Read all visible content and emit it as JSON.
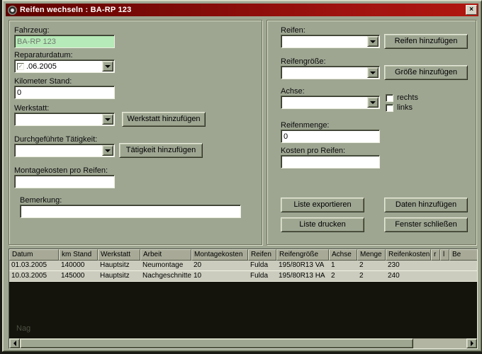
{
  "window": {
    "title": "Reifen wechseln : BA-RP 123",
    "close_glyph": "×"
  },
  "form_left": {
    "fahrzeug": {
      "label": "Fahrzeug:",
      "value": "BA-RP 123"
    },
    "reparaturdatum": {
      "label": "Reparaturdatum:",
      "value": ".06.2005",
      "check_glyph": "✓"
    },
    "kilometer": {
      "label": "Kilometer Stand:",
      "value": "0"
    },
    "werkstatt": {
      "label": "Werkstatt:",
      "add_button": "Werkstatt hinzufügen"
    },
    "taetigkeit": {
      "label": "Durchgeführte Tätigkeit:",
      "add_button": "Tätigkeit hinzufügen"
    },
    "montagekosten": {
      "label": "Montagekosten pro Reifen:",
      "value": ""
    },
    "bemerkung": {
      "label": "Bemerkung:",
      "value": ""
    }
  },
  "form_right": {
    "reifen": {
      "label": "Reifen:",
      "add_button": "Reifen hinzufügen"
    },
    "reifengroesse": {
      "label": "Reifengröße:",
      "add_button": "Größe hinzufügen"
    },
    "achse": {
      "label": "Achse:",
      "rechts": "rechts",
      "links": "links"
    },
    "reifenmenge": {
      "label": "Reifenmenge:",
      "value": "0"
    },
    "kosten": {
      "label": "Kosten pro Reifen:",
      "value": ""
    },
    "buttons": {
      "export": "Liste exportieren",
      "add": "Daten hinzufügen",
      "print": "Liste drucken",
      "close": "Fenster schließen"
    }
  },
  "table": {
    "columns": [
      "Datum",
      "km Stand",
      "Werkstatt",
      "Arbeit",
      "Montagekosten",
      "Reifen",
      "Reifengröße",
      "Achse",
      "Menge",
      "Reifenkosten",
      "r",
      "l",
      "Be"
    ],
    "rows": [
      [
        "01.03.2005",
        "140000",
        "Hauptsitz",
        "Neumontage",
        "20",
        "Fulda",
        "195/80R13 VA",
        "1",
        "2",
        "230",
        "",
        "",
        ""
      ],
      [
        "10.03.2005",
        "145000",
        "Hauptsitz",
        "Nachgeschnitten",
        "10",
        "Fulda",
        "195/80R13 HA",
        "2",
        "2",
        "240",
        "",
        "",
        ""
      ]
    ],
    "watermark": "Nag"
  },
  "colors": {
    "titlebar_from": "#5e0300",
    "titlebar_to": "#b0170f",
    "dialog_bg": "#9ea692",
    "field_green": "#b6eab8",
    "table_dark": "#14140c",
    "row_bg": "#cbccbd"
  }
}
